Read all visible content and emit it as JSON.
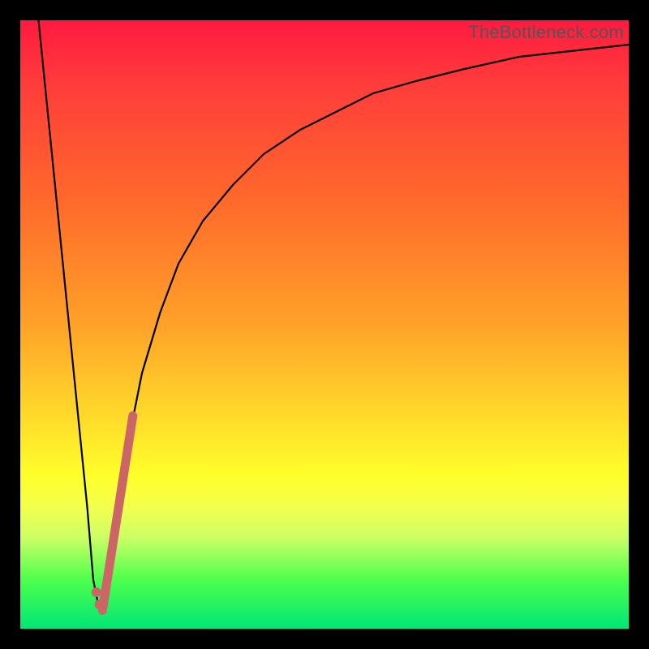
{
  "watermark": "TheBottleneck.com",
  "chart_data": {
    "type": "line",
    "title": "",
    "xlabel": "",
    "ylabel": "",
    "xlim": [
      0,
      100
    ],
    "ylim": [
      0,
      100
    ],
    "grid": false,
    "series": [
      {
        "name": "bottleneck-curve",
        "color": "#000000",
        "x": [
          3,
          5,
          7,
          9,
          11,
          12,
          13,
          14,
          16,
          18,
          20,
          23,
          26,
          30,
          35,
          40,
          46,
          52,
          58,
          65,
          73,
          82,
          91,
          100
        ],
        "y": [
          100,
          80,
          60,
          40,
          20,
          8,
          3,
          6,
          20,
          32,
          42,
          52,
          60,
          67,
          73,
          78,
          82,
          85,
          88,
          90,
          92,
          94,
          95,
          96
        ]
      },
      {
        "name": "highlight-segment",
        "color": "#cc6666",
        "x": [
          13.5,
          18.5
        ],
        "y": [
          3,
          35
        ]
      }
    ],
    "markers": [
      {
        "name": "highlight-bottom",
        "x": 13.0,
        "y": 4
      },
      {
        "name": "highlight-top-offset",
        "x": 12.5,
        "y": 6
      }
    ],
    "background": "rainbow-vertical-red-to-green"
  }
}
